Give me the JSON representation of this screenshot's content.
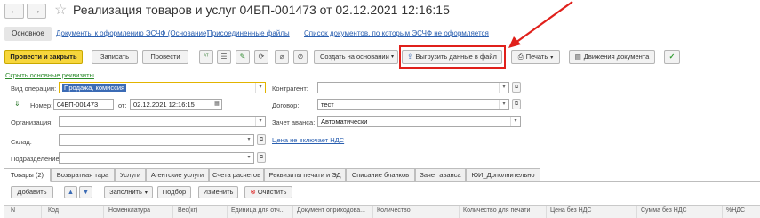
{
  "window": {
    "back_glyph": "←",
    "forward_glyph": "→",
    "title": "Реализация товаров и услуг 04БП-001473 от 02.12.2021 12:16:15"
  },
  "nav": {
    "main_tab": "Основное",
    "links": [
      "Документы к оформлению ЭСЧФ (Основание)",
      "Присоединенные файлы",
      "Список документов, по которым  ЭСЧФ не оформляется"
    ]
  },
  "toolbar": {
    "post_close": "Провести и закрыть",
    "save": "Записать",
    "post": "Провести",
    "create_based": "Создать на основании",
    "export_file": "Выгрузить данные в файл",
    "print": "Печать",
    "movements": "Движения документа"
  },
  "hide_details_link": "Скрыть основные реквизиты",
  "form": {
    "operation_label": "Вид операции:",
    "operation_value": "Продажа, комиссия",
    "number_label": "Номер:",
    "number_value": "04БП-001473",
    "date_label": "от:",
    "date_value": "02.12.2021 12:16:15",
    "org_label": "Организация:",
    "org_value": "",
    "warehouse_label": "Склад:",
    "warehouse_value": "",
    "division_label": "Подразделение:",
    "division_value": "",
    "counterparty_label": "Контрагент:",
    "counterparty_value": "",
    "contract_label": "Договор:",
    "contract_value": "тест",
    "advance_label": "Зачет аванса:",
    "advance_value": "Автоматически",
    "vat_link": "Цена не включает НДС"
  },
  "tabs": [
    "Товары (2)",
    "Возвратная тара",
    "Услуги",
    "Агентские услуги",
    "Счета расчетов",
    "Реквизиты печати и ЭД",
    "Списание бланков",
    "Зачет аванса",
    "ЮИ_Дополнительно"
  ],
  "table_toolbar": {
    "add": "Добавить",
    "fill": "Заполнить",
    "pick": "Подбор",
    "change": "Изменить",
    "clear": "Очистить"
  },
  "columns": [
    "N",
    "Код",
    "Номенклатура",
    "Вес(кг)",
    "Единица для отч...",
    "Документ оприходова...",
    "Количество",
    "Количество для печати",
    "Цена без НДС",
    "Сумма без НДС",
    "%НДС"
  ],
  "colors": {
    "accent_yellow": "#f7d63c",
    "link_blue": "#2a5fb0",
    "highlight_red": "#e0201b",
    "hide_link_green": "#2b8a2b",
    "selected_blue": "#3b6bb5"
  }
}
